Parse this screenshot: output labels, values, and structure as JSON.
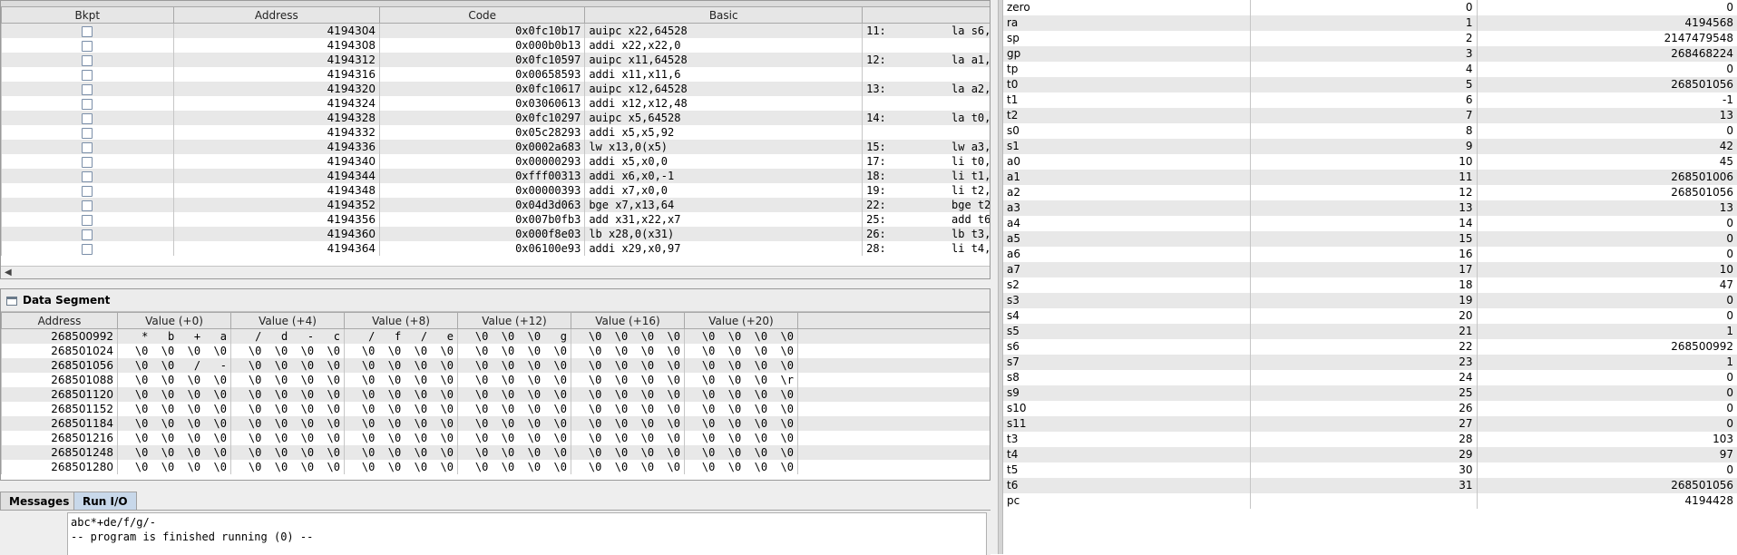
{
  "text_segment": {
    "columns": [
      "Bkpt",
      "Address",
      "Code",
      "Basic",
      ""
    ],
    "rows": [
      {
        "address": "4194304",
        "code": "0x0fc10b17",
        "basic": "auipc x22,64528",
        "source": "11:          la s6,"
      },
      {
        "address": "4194308",
        "code": "0x000b0b13",
        "basic": "addi x22,x22,0",
        "source": ""
      },
      {
        "address": "4194312",
        "code": "0x0fc10597",
        "basic": "auipc x11,64528",
        "source": "12:          la a1,"
      },
      {
        "address": "4194316",
        "code": "0x00658593",
        "basic": "addi x11,x11,6",
        "source": ""
      },
      {
        "address": "4194320",
        "code": "0x0fc10617",
        "basic": "auipc x12,64528",
        "source": "13:          la a2,"
      },
      {
        "address": "4194324",
        "code": "0x03060613",
        "basic": "addi x12,x12,48",
        "source": ""
      },
      {
        "address": "4194328",
        "code": "0x0fc10297",
        "basic": "auipc x5,64528",
        "source": "14:          la t0,"
      },
      {
        "address": "4194332",
        "code": "0x05c28293",
        "basic": "addi x5,x5,92",
        "source": ""
      },
      {
        "address": "4194336",
        "code": "0x0002a683",
        "basic": "lw x13,0(x5)",
        "source": "15:          lw a3,"
      },
      {
        "address": "4194340",
        "code": "0x00000293",
        "basic": "addi x5,x0,0",
        "source": "17:          li t0,"
      },
      {
        "address": "4194344",
        "code": "0xfff00313",
        "basic": "addi x6,x0,-1",
        "source": "18:          li t1,"
      },
      {
        "address": "4194348",
        "code": "0x00000393",
        "basic": "addi x7,x0,0",
        "source": "19:          li t2,"
      },
      {
        "address": "4194352",
        "code": "0x04d3d063",
        "basic": "bge x7,x13,64",
        "source": "22:          bge t2,"
      },
      {
        "address": "4194356",
        "code": "0x007b0fb3",
        "basic": "add x31,x22,x7",
        "source": "25:          add t6,"
      },
      {
        "address": "4194360",
        "code": "0x000f8e03",
        "basic": "lb x28,0(x31)",
        "source": "26:          lb t3,"
      },
      {
        "address": "4194364",
        "code": "0x06100e93",
        "basic": "addi x29,x0,97",
        "source": "28:          li t4,"
      }
    ]
  },
  "data_segment": {
    "title": "Data Segment",
    "columns": [
      "Address",
      "Value (+0)",
      "Value (+4)",
      "Value (+8)",
      "Value (+12)",
      "Value (+16)",
      "Value (+20)"
    ],
    "rows": [
      [
        "268500992",
        "  *   b   +   a",
        "  /   d   -   c",
        "  /   f   /   e",
        " \\0  \\0  \\0   g",
        " \\0  \\0  \\0  \\0",
        " \\0  \\0  \\0  \\0"
      ],
      [
        "268501024",
        " \\0  \\0  \\0  \\0",
        " \\0  \\0  \\0  \\0",
        " \\0  \\0  \\0  \\0",
        " \\0  \\0  \\0  \\0",
        " \\0  \\0  \\0  \\0",
        " \\0  \\0  \\0  \\0"
      ],
      [
        "268501056",
        " \\0  \\0   /   -",
        " \\0  \\0  \\0  \\0",
        " \\0  \\0  \\0  \\0",
        " \\0  \\0  \\0  \\0",
        " \\0  \\0  \\0  \\0",
        " \\0  \\0  \\0  \\0"
      ],
      [
        "268501088",
        " \\0  \\0  \\0  \\0",
        " \\0  \\0  \\0  \\0",
        " \\0  \\0  \\0  \\0",
        " \\0  \\0  \\0  \\0",
        " \\0  \\0  \\0  \\0",
        " \\0  \\0  \\0  \\r"
      ],
      [
        "268501120",
        " \\0  \\0  \\0  \\0",
        " \\0  \\0  \\0  \\0",
        " \\0  \\0  \\0  \\0",
        " \\0  \\0  \\0  \\0",
        " \\0  \\0  \\0  \\0",
        " \\0  \\0  \\0  \\0"
      ],
      [
        "268501152",
        " \\0  \\0  \\0  \\0",
        " \\0  \\0  \\0  \\0",
        " \\0  \\0  \\0  \\0",
        " \\0  \\0  \\0  \\0",
        " \\0  \\0  \\0  \\0",
        " \\0  \\0  \\0  \\0"
      ],
      [
        "268501184",
        " \\0  \\0  \\0  \\0",
        " \\0  \\0  \\0  \\0",
        " \\0  \\0  \\0  \\0",
        " \\0  \\0  \\0  \\0",
        " \\0  \\0  \\0  \\0",
        " \\0  \\0  \\0  \\0"
      ],
      [
        "268501216",
        " \\0  \\0  \\0  \\0",
        " \\0  \\0  \\0  \\0",
        " \\0  \\0  \\0  \\0",
        " \\0  \\0  \\0  \\0",
        " \\0  \\0  \\0  \\0",
        " \\0  \\0  \\0  \\0"
      ],
      [
        "268501248",
        " \\0  \\0  \\0  \\0",
        " \\0  \\0  \\0  \\0",
        " \\0  \\0  \\0  \\0",
        " \\0  \\0  \\0  \\0",
        " \\0  \\0  \\0  \\0",
        " \\0  \\0  \\0  \\0"
      ],
      [
        "268501280",
        " \\0  \\0  \\0  \\0",
        " \\0  \\0  \\0  \\0",
        " \\0  \\0  \\0  \\0",
        " \\0  \\0  \\0  \\0",
        " \\0  \\0  \\0  \\0",
        " \\0  \\0  \\0  \\0"
      ]
    ]
  },
  "io_panel": {
    "tabs": [
      "Messages",
      "Run I/O"
    ],
    "active_tab": "Run I/O",
    "lines": [
      "abc*+de/f/g/-",
      "-- program is finished running (0) --"
    ]
  },
  "registers": [
    [
      "zero",
      "0",
      "0"
    ],
    [
      "ra",
      "1",
      "4194568"
    ],
    [
      "sp",
      "2",
      "2147479548"
    ],
    [
      "gp",
      "3",
      "268468224"
    ],
    [
      "tp",
      "4",
      "0"
    ],
    [
      "t0",
      "5",
      "268501056"
    ],
    [
      "t1",
      "6",
      "-1"
    ],
    [
      "t2",
      "7",
      "13"
    ],
    [
      "s0",
      "8",
      "0"
    ],
    [
      "s1",
      "9",
      "42"
    ],
    [
      "a0",
      "10",
      "45"
    ],
    [
      "a1",
      "11",
      "268501006"
    ],
    [
      "a2",
      "12",
      "268501056"
    ],
    [
      "a3",
      "13",
      "13"
    ],
    [
      "a4",
      "14",
      "0"
    ],
    [
      "a5",
      "15",
      "0"
    ],
    [
      "a6",
      "16",
      "0"
    ],
    [
      "a7",
      "17",
      "10"
    ],
    [
      "s2",
      "18",
      "47"
    ],
    [
      "s3",
      "19",
      "0"
    ],
    [
      "s4",
      "20",
      "0"
    ],
    [
      "s5",
      "21",
      "1"
    ],
    [
      "s6",
      "22",
      "268500992"
    ],
    [
      "s7",
      "23",
      "1"
    ],
    [
      "s8",
      "24",
      "0"
    ],
    [
      "s9",
      "25",
      "0"
    ],
    [
      "s10",
      "26",
      "0"
    ],
    [
      "s11",
      "27",
      "0"
    ],
    [
      "t3",
      "28",
      "103"
    ],
    [
      "t4",
      "29",
      "97"
    ],
    [
      "t5",
      "30",
      "0"
    ],
    [
      "t6",
      "31",
      "268501056"
    ],
    [
      "pc",
      "",
      "4194428"
    ]
  ],
  "icons": {
    "scroll_left": "◀",
    "window_icon": "window-icon"
  }
}
